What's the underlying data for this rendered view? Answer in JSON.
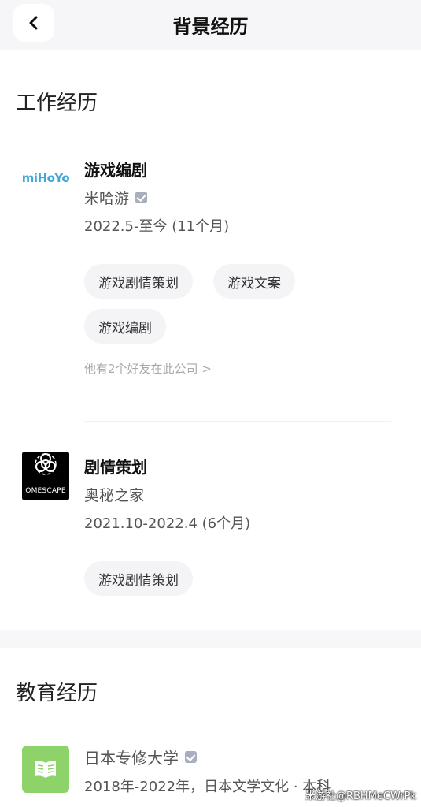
{
  "header": {
    "title": "背景经历"
  },
  "work": {
    "section_title": "工作经历",
    "jobs": [
      {
        "logo_text": "miHoYo",
        "title": "游戏编剧",
        "company": "米哈游",
        "dates": "2022.5-至今 (11个月)",
        "tags": [
          "游戏剧情策划",
          "游戏文案",
          "游戏编剧"
        ],
        "friends_note": "他有2个好友在此公司 >"
      },
      {
        "logo_text": "OMESCAPE",
        "title": "剧情策划",
        "company": "奥秘之家",
        "dates": "2021.10-2022.4 (6个月)",
        "tags": [
          "游戏剧情策划"
        ]
      }
    ]
  },
  "education": {
    "section_title": "教育经历",
    "school": "日本专修大学",
    "details": "2018年-2022年，日本文学文化 · 本科"
  },
  "watermark": "米游社@RBHMeCWrPk",
  "colors": {
    "mihoyo_blue": "#3fa8d8",
    "edu_green": "#8ed36a",
    "tag_bg": "#f4f4f6"
  }
}
